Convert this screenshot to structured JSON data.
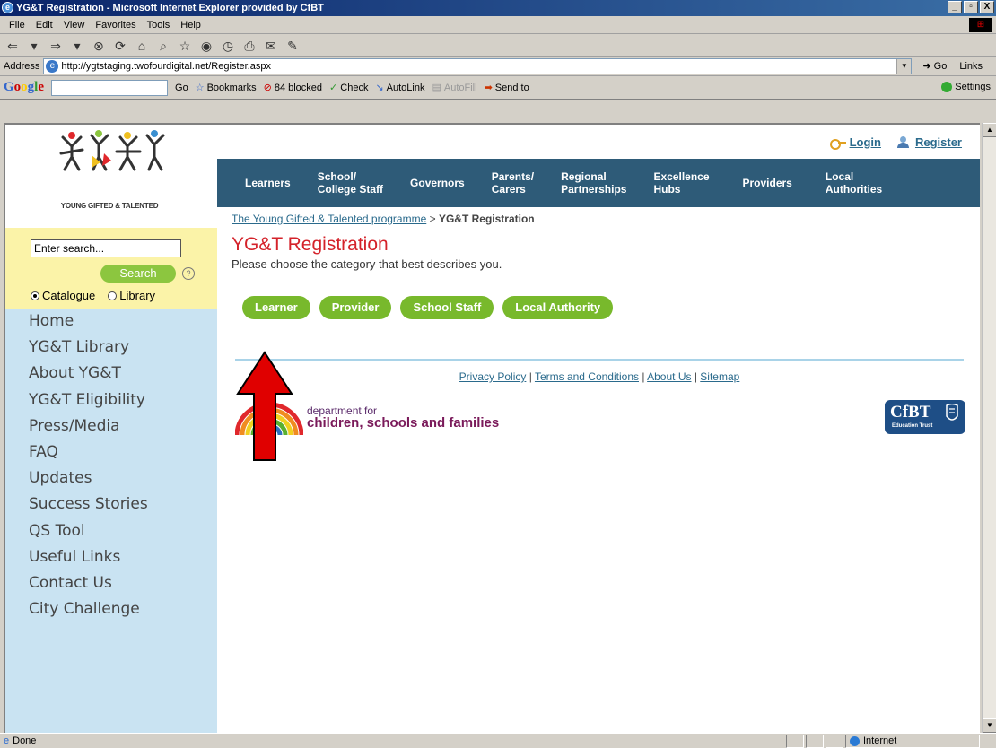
{
  "window": {
    "title": "YG&T Registration - Microsoft Internet Explorer provided by CfBT",
    "minimize": "_",
    "maximize": "▫",
    "close": "X"
  },
  "menubar": [
    "File",
    "Edit",
    "View",
    "Favorites",
    "Tools",
    "Help"
  ],
  "address": {
    "label": "Address",
    "url": "http://ygtstaging.twofourdigital.net/Register.aspx",
    "go": "Go",
    "links": "Links"
  },
  "googlebar": {
    "go": "Go",
    "bookmarks": "Bookmarks",
    "blocked": "84 blocked",
    "check": "Check",
    "autolink": "AutoLink",
    "autofill": "AutoFill",
    "sendto": "Send to",
    "settings": "Settings"
  },
  "status": {
    "text": "Done",
    "zone": "Internet"
  },
  "page": {
    "logo_text": "YOUNG GIFTED & TALENTED",
    "search": {
      "value": "Enter search...",
      "button": "Search",
      "help": "?",
      "options": [
        "Catalogue",
        "Library"
      ]
    },
    "sidenav": [
      "Home",
      "YG&T Library",
      "About YG&T",
      "YG&T Eligibility",
      "Press/Media",
      "FAQ",
      "Updates",
      "Success Stories",
      "QS Tool",
      "Useful Links",
      "Contact Us",
      "City Challenge"
    ],
    "toplinks": {
      "login": "Login",
      "register": "Register"
    },
    "mainnav": [
      "Learners",
      "School/\nCollege Staff",
      "Governors",
      "Parents/\nCarers",
      "Regional\nPartnerships",
      "Excellence\nHubs",
      "Providers",
      "Local\nAuthorities"
    ],
    "breadcrumb": {
      "link": "The Young Gifted & Talented programme",
      "separator": " > ",
      "current": "YG&T Registration"
    },
    "title": "YG&T Registration",
    "subtitle": "Please choose the category that best describes you.",
    "categories": [
      "Learner",
      "Provider",
      "School Staff",
      "Local Authority"
    ],
    "footer": {
      "links": [
        "Privacy Policy",
        "Terms and Conditions",
        "About Us",
        "Sitemap"
      ],
      "separator": " | "
    },
    "dcsf": {
      "line1": "department for",
      "line2": "children, schools and families"
    },
    "cfbt": {
      "name": "CfBT",
      "tagline": "Education Trust"
    }
  },
  "colors": {
    "nav_bar": "#2e5b78",
    "button_green": "#78b92c",
    "title_red": "#d4222a",
    "annotation_arrow": "#e00000"
  }
}
